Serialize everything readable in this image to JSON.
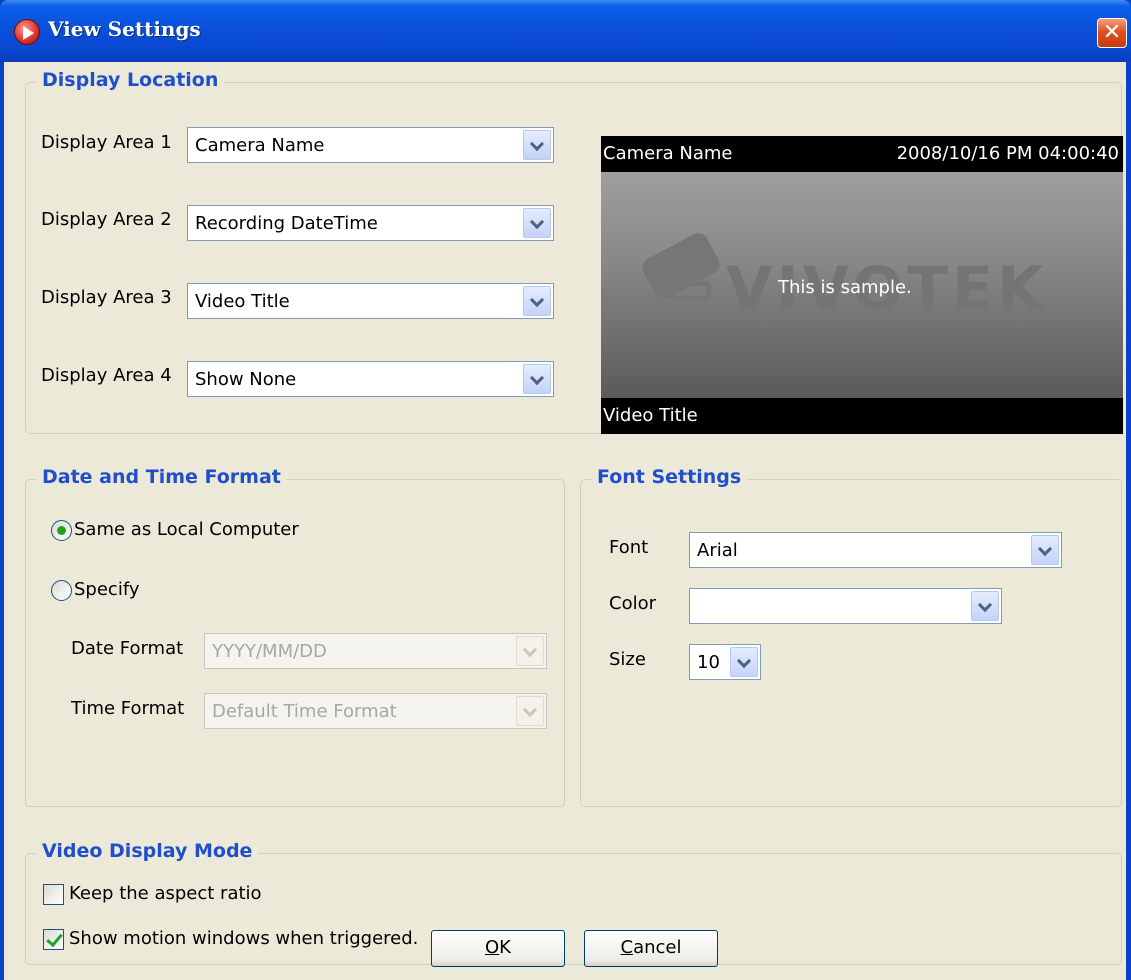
{
  "window": {
    "title": "View Settings",
    "close_glyph": "✕"
  },
  "display_location": {
    "legend": "Display Location",
    "areas": [
      {
        "label": "Display Area 1",
        "value": "Camera Name"
      },
      {
        "label": "Display Area 2",
        "value": "Recording DateTime"
      },
      {
        "label": "Display Area 3",
        "value": "Video Title"
      },
      {
        "label": "Display Area 4",
        "value": "Show None"
      }
    ],
    "preview": {
      "top_left": "Camera Name",
      "top_right": "2008/10/16 PM 04:00:40",
      "logo": "VIVOTEK",
      "center": "This is sample.",
      "bottom_left": "Video Title"
    }
  },
  "date_time": {
    "legend": "Date and Time Format",
    "same_as_local": "Same as Local Computer",
    "same_as_local_checked": true,
    "specify": "Specify",
    "specify_checked": false,
    "date_format_label": "Date Format",
    "date_format_value": "YYYY/MM/DD",
    "time_format_label": "Time Format",
    "time_format_value": "Default Time Format"
  },
  "font_settings": {
    "legend": "Font Settings",
    "font_label": "Font",
    "font_value": "Arial",
    "color_label": "Color",
    "color_value": "",
    "size_label": "Size",
    "size_value": "10"
  },
  "video_display": {
    "legend": "Video Display Mode",
    "keep_aspect": "Keep the aspect ratio",
    "keep_aspect_checked": false,
    "show_motion": "Show motion windows when triggered.",
    "show_motion_checked": true
  },
  "buttons": {
    "ok_access": "O",
    "ok_rest": "K",
    "cancel_access": "C",
    "cancel_rest": "ancel"
  },
  "colors": {
    "title_bar": "#0a4fd8",
    "legend_text": "#1f4fcc",
    "dialog_bg": "#ece9d8"
  }
}
